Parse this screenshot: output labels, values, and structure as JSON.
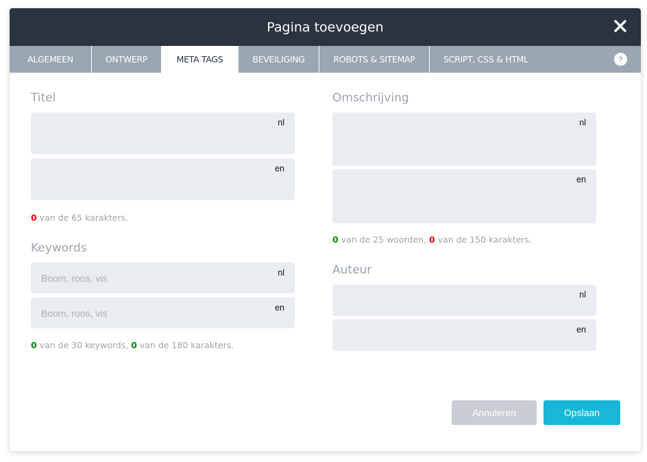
{
  "dialog": {
    "title": "Pagina toevoegen",
    "close_icon": "close-icon",
    "help_icon": "question-icon",
    "help_label": "?"
  },
  "tabs": [
    {
      "label": "ALGEMEEN",
      "active": false
    },
    {
      "label": "ONTWERP",
      "active": false
    },
    {
      "label": "META TAGS",
      "active": true
    },
    {
      "label": "BEVEILIGING",
      "active": false
    },
    {
      "label": "ROBOTS & SITEMAP",
      "active": false
    },
    {
      "label": "SCRIPT, CSS & HTML",
      "active": false
    }
  ],
  "titel": {
    "label": "Titel",
    "fields": [
      {
        "lang": "nl",
        "value": "",
        "placeholder": ""
      },
      {
        "lang": "en",
        "value": "",
        "placeholder": ""
      }
    ],
    "counter": {
      "count": "0",
      "text": " van de 65 karakters."
    }
  },
  "keywords": {
    "label": "Keywords",
    "fields": [
      {
        "lang": "nl",
        "value": "",
        "placeholder": "Boom, roos, vis"
      },
      {
        "lang": "en",
        "value": "",
        "placeholder": "Boom, roos, vis"
      }
    ],
    "counter": {
      "count1": "0",
      "text1": " van de 30 keywords, ",
      "count2": "0",
      "text2": " van de 180 karakters."
    }
  },
  "omschrijving": {
    "label": "Omschrijving",
    "fields": [
      {
        "lang": "nl",
        "value": "",
        "placeholder": ""
      },
      {
        "lang": "en",
        "value": "",
        "placeholder": ""
      }
    ],
    "counter": {
      "count1": "0",
      "text1": " van de 25 woorden, ",
      "count2": "0",
      "text2": " van de 150 karakters."
    }
  },
  "auteur": {
    "label": "Auteur",
    "fields": [
      {
        "lang": "nl",
        "value": "",
        "placeholder": ""
      },
      {
        "lang": "en",
        "value": "",
        "placeholder": ""
      }
    ]
  },
  "buttons": {
    "cancel": "Annuleren",
    "save": "Opslaan"
  },
  "colors": {
    "header_bg": "#2b333e",
    "tabs_bg": "#9aa6b1",
    "field_bg": "#e9ecf0",
    "accent": "#17b8d7",
    "counter_red": "#ff0000",
    "counter_green": "#008a00"
  }
}
